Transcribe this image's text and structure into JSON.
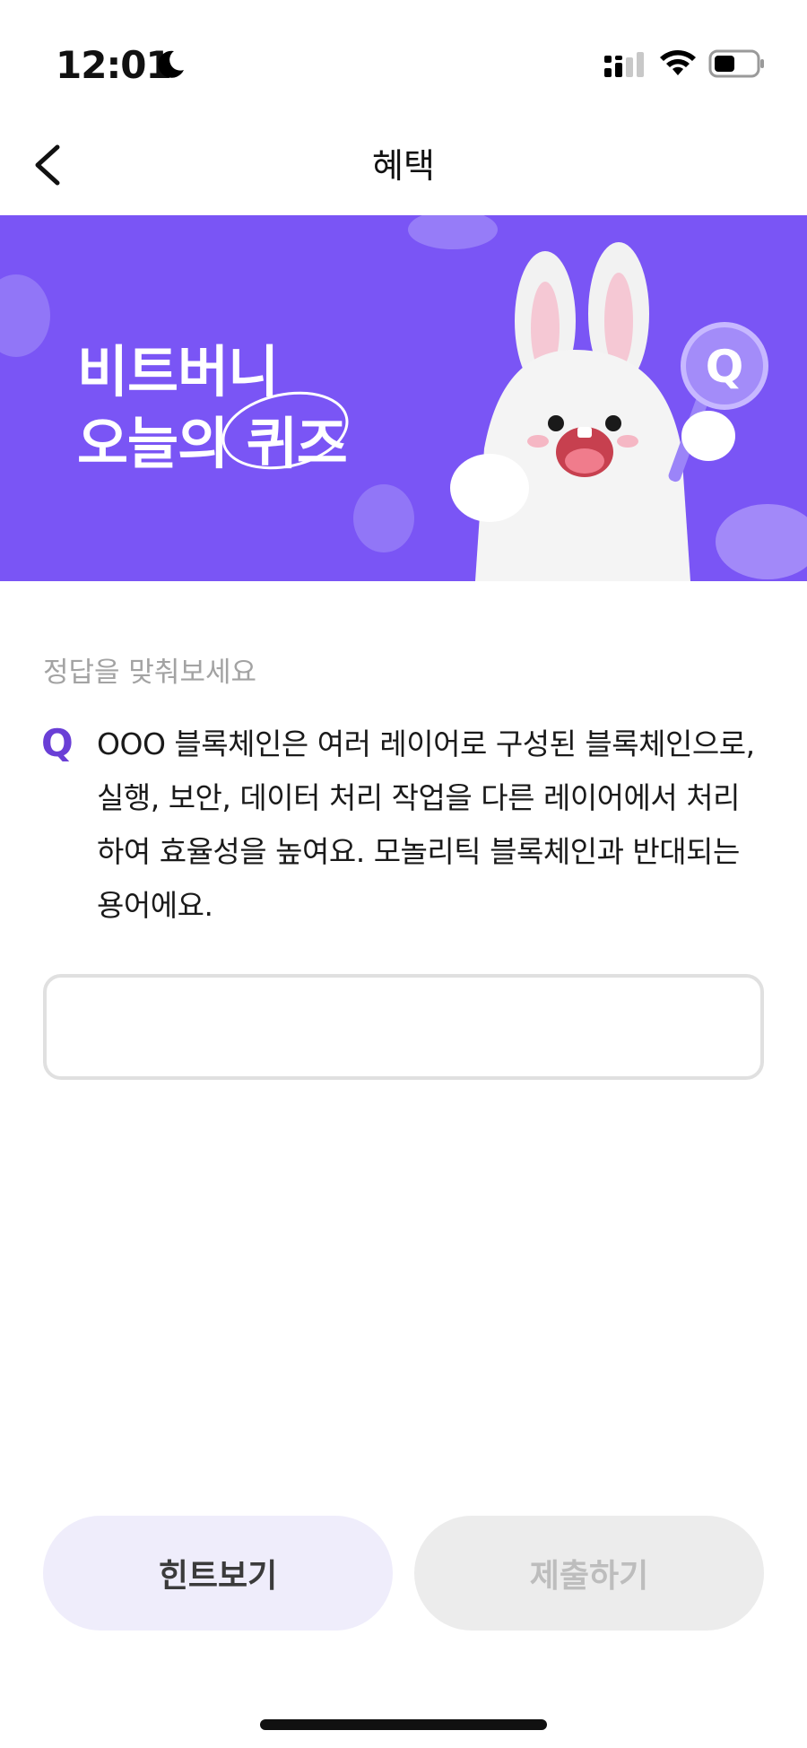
{
  "status_bar": {
    "time": "12:01",
    "icons": [
      "moon-icon",
      "cellular-signal-icon",
      "wifi-icon",
      "battery-icon"
    ]
  },
  "nav": {
    "title": "혜택",
    "back_icon": "chevron-left-icon"
  },
  "banner": {
    "line1": "비트버니",
    "line2": "오늘의 퀴즈",
    "background_color": "#7a55f5",
    "badge_letter": "Q"
  },
  "quiz": {
    "prompt": "정답을 맞춰보세요",
    "q_mark": "Q",
    "question": "OOO 블록체인은 여러 레이어로 구성된 블록체인으로, 실행, 보안, 데이터 처리 작업을 다른 레이어에서 처리하여 효율성을 높여요. 모놀리틱 블록체인과 반대되는 용어에요.",
    "answer_value": "",
    "answer_placeholder": ""
  },
  "actions": {
    "hint_label": "힌트보기",
    "submit_label": "제출하기"
  },
  "colors": {
    "accent": "#6a3fd6",
    "hint_bg": "#efedfb",
    "submit_disabled_bg": "#ececec"
  }
}
